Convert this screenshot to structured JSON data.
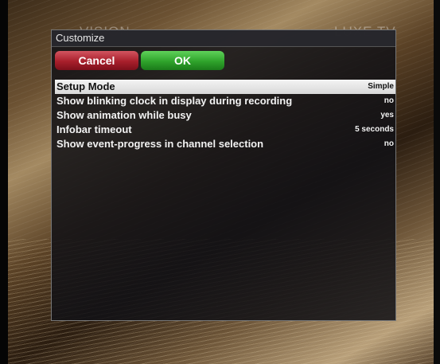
{
  "watermarks": {
    "left": "VISION",
    "right": "LUXE TV"
  },
  "dialog": {
    "title": "Customize",
    "buttons": {
      "cancel": "Cancel",
      "ok": "OK"
    },
    "colors": {
      "cancel": "#a81f2b",
      "ok": "#2fa32b"
    },
    "settings": [
      {
        "label": "Setup Mode",
        "value": "Simple",
        "selected": true
      },
      {
        "label": "Show blinking clock in display during recording",
        "value": "no",
        "selected": false
      },
      {
        "label": "Show animation while busy",
        "value": "yes",
        "selected": false
      },
      {
        "label": "Infobar timeout",
        "value": "5 seconds",
        "selected": false
      },
      {
        "label": "Show event-progress in channel selection",
        "value": "no",
        "selected": false
      }
    ]
  }
}
